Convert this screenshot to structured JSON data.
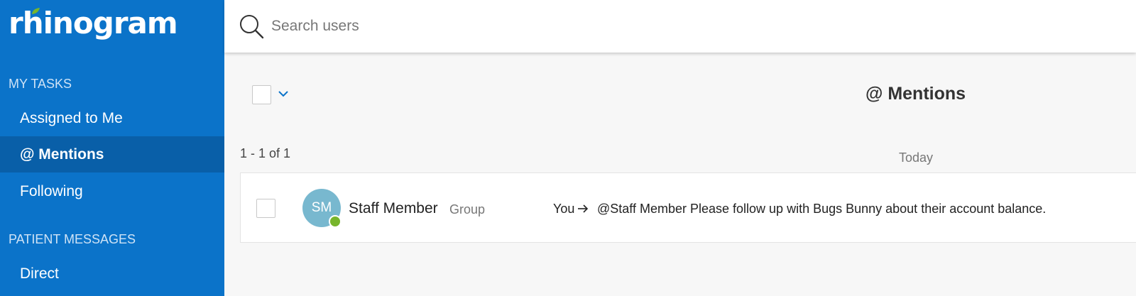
{
  "app": {
    "logo_text": "rhinogram",
    "brand_color": "#0b73c9",
    "leaf_color": "#77b52c"
  },
  "sidebar": {
    "sections": [
      {
        "title": "MY TASKS",
        "items": [
          {
            "label": "Assigned to Me",
            "active": false
          },
          {
            "label": "@ Mentions",
            "active": true
          },
          {
            "label": "Following",
            "active": false
          }
        ]
      },
      {
        "title": "PATIENT MESSAGES",
        "items": [
          {
            "label": "Direct",
            "active": false
          }
        ]
      }
    ]
  },
  "search": {
    "placeholder": "Search users",
    "value": "",
    "icon": "search-icon"
  },
  "main": {
    "title": "@ Mentions",
    "pagination": "1 - 1 of 1",
    "date_group": "Today",
    "rows": [
      {
        "avatar_initials": "SM",
        "avatar_color": "#78b8cf",
        "online": true,
        "sender": "Staff Member",
        "sender_type": "Group",
        "from": "You",
        "message": "@Staff Member Please follow up with Bugs Bunny about their account balance."
      }
    ]
  }
}
